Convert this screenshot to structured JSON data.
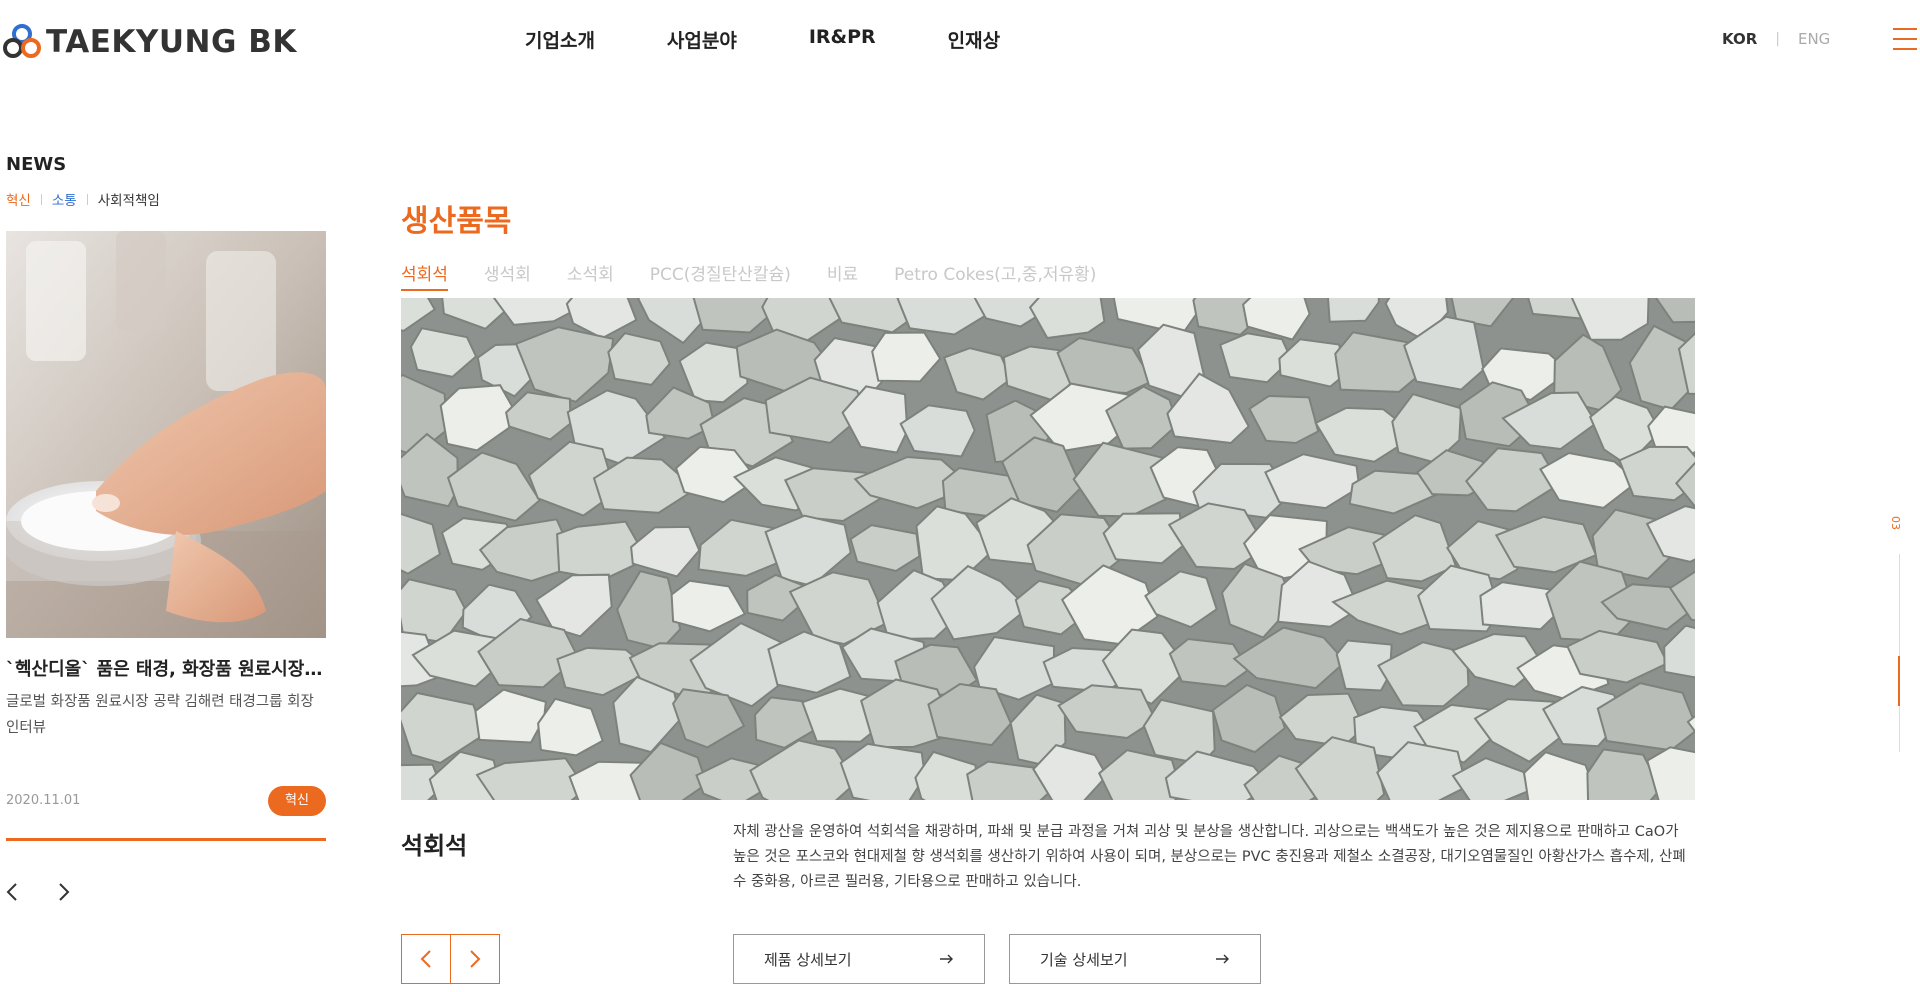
{
  "header": {
    "logo_text": "TAEKYUNG BK",
    "nav": [
      "기업소개",
      "사업분야",
      "IR&PR",
      "인재상"
    ],
    "lang_kor": "KOR",
    "lang_sep": "|",
    "lang_eng": "ENG",
    "menu_icon": "hamburger-icon"
  },
  "news": {
    "title": "NEWS",
    "tabs": [
      {
        "label": "혁신",
        "color": "#ec6a1f"
      },
      {
        "label": "소통",
        "color": "#2f6fd1"
      },
      {
        "label": "사회적책임",
        "color": "#333333"
      }
    ],
    "headline": "`헥산디올` 품은 태경, 화장품 원료시장 공략",
    "summary": "글로벌 화장품 원료시장 공략 김해련 태경그룹 회장 인터뷰",
    "date": "2020.11.01",
    "badge": "혁신",
    "prev_icon": "chevron-left-icon",
    "next_icon": "chevron-right-icon"
  },
  "products": {
    "title": "생산품목",
    "tabs": [
      "석회석",
      "생석회",
      "소석회",
      "PCC(경질탄산칼슘)",
      "비료",
      "Petro Cokes(고,중,저유황)"
    ],
    "active_tab": 0,
    "name": "석회석",
    "description": "자체 광산을 운영하여 석회석을 채광하며, 파쇄 및 분급 과정을 거쳐 괴상 및 분상을 생산합니다. 괴상으로는 백색도가 높은 것은 제지용으로 판매하고 CaO가 높은 것은 포스코와 현대제철 향 생석회를 생산하기 위하여 사용이 되며, 분상으로는 PVC 충진용과 제철소 소결공장, 대기오염물질인 아황산가스 흡수제, 산폐수 중화용, 아르콘 필러용, 기타용으로 판매하고 있습니다.",
    "btn_product": "제품 상세보기",
    "btn_tech": "기술 상세보기"
  },
  "indicator": {
    "number": "03"
  },
  "colors": {
    "accent": "#ec6a1f"
  }
}
